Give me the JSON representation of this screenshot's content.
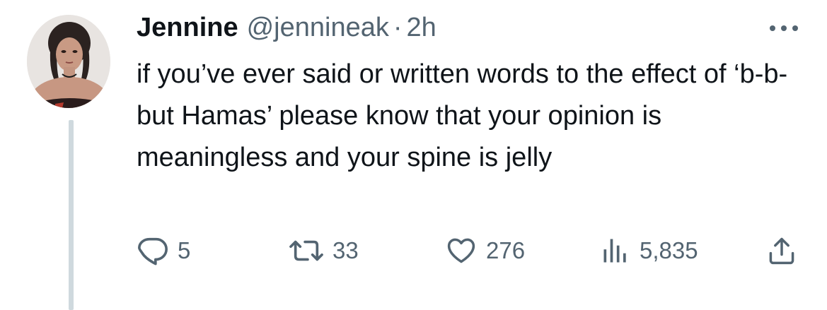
{
  "tweet": {
    "display_name": "Jennine",
    "handle": "@jennineak",
    "separator": "·",
    "time": "2h",
    "text": "if you’ve ever said or written words to the effect of ‘b-b-but Hamas’ please know that your opinion is meaningless and your spine is jelly"
  },
  "actions": {
    "reply": {
      "icon": "reply-icon",
      "count": "5"
    },
    "retweet": {
      "icon": "retweet-icon",
      "count": "33"
    },
    "like": {
      "icon": "heart-icon",
      "count": "276"
    },
    "views": {
      "icon": "views-icon",
      "count": "5,835"
    },
    "share": {
      "icon": "share-icon"
    }
  },
  "colors": {
    "text": "#0f1419",
    "secondary": "#536471",
    "thread_line": "#cfd9de",
    "background": "#ffffff"
  }
}
